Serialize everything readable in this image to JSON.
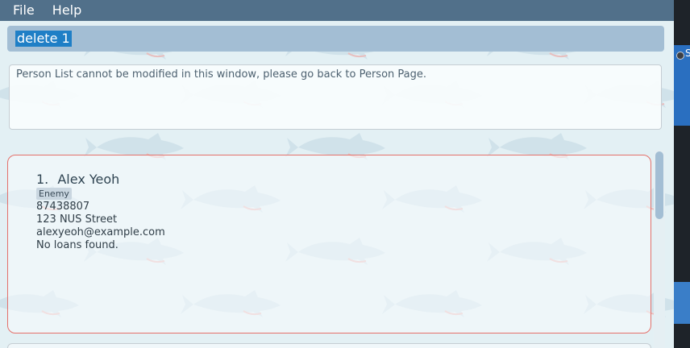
{
  "menu": {
    "file": "File",
    "help": "Help"
  },
  "command_box": {
    "value": "delete 1"
  },
  "result_box": {
    "text": "Person List cannot be modified in this window, please go back to Person Page."
  },
  "person_card": {
    "index": "1.",
    "name": "Alex Yeoh",
    "tag": "Enemy",
    "phone": "87438807",
    "address": "123 NUS Street",
    "email": "alexyeoh@example.com",
    "loans": "No loans found."
  },
  "side_strip": {
    "partial_text": "S"
  },
  "colors": {
    "menubar": "#51708a",
    "command_box": "#a3bed4",
    "selection": "#1f7fc6",
    "card_border": "#e4706a",
    "background": "#e3f0f4"
  }
}
